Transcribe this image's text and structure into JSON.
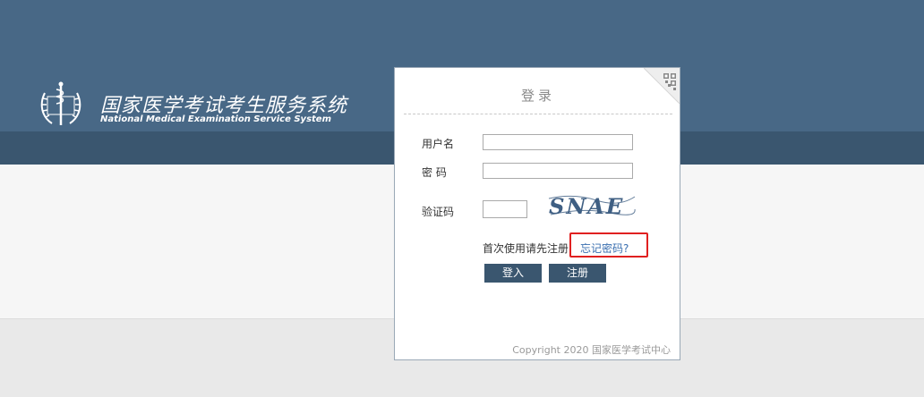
{
  "header": {
    "title": "国家医学考试考生服务系统",
    "subtitle": "National Medical Examination Service System"
  },
  "login": {
    "title": "登录",
    "username_label": "用户名",
    "password_label": "密 码",
    "captcha_label": "验证码",
    "username_value": "",
    "password_value": "",
    "captcha_value": "",
    "captcha_text": "SNAE",
    "first_use_text": "首次使用请先注册",
    "forgot_link": "忘记密码?",
    "login_button": "登入",
    "register_button": "注册"
  },
  "footer": {
    "copyright": "Copyright 2020 国家医学考试中心"
  },
  "icons": {
    "emblem": "medical-emblem-icon",
    "qr": "qr-code-icon"
  },
  "colors": {
    "header_bg": "#486886",
    "header_band": "#3a566f",
    "button_bg": "#3a566f",
    "link": "#3a6fb0",
    "highlight_box": "#e02020"
  }
}
